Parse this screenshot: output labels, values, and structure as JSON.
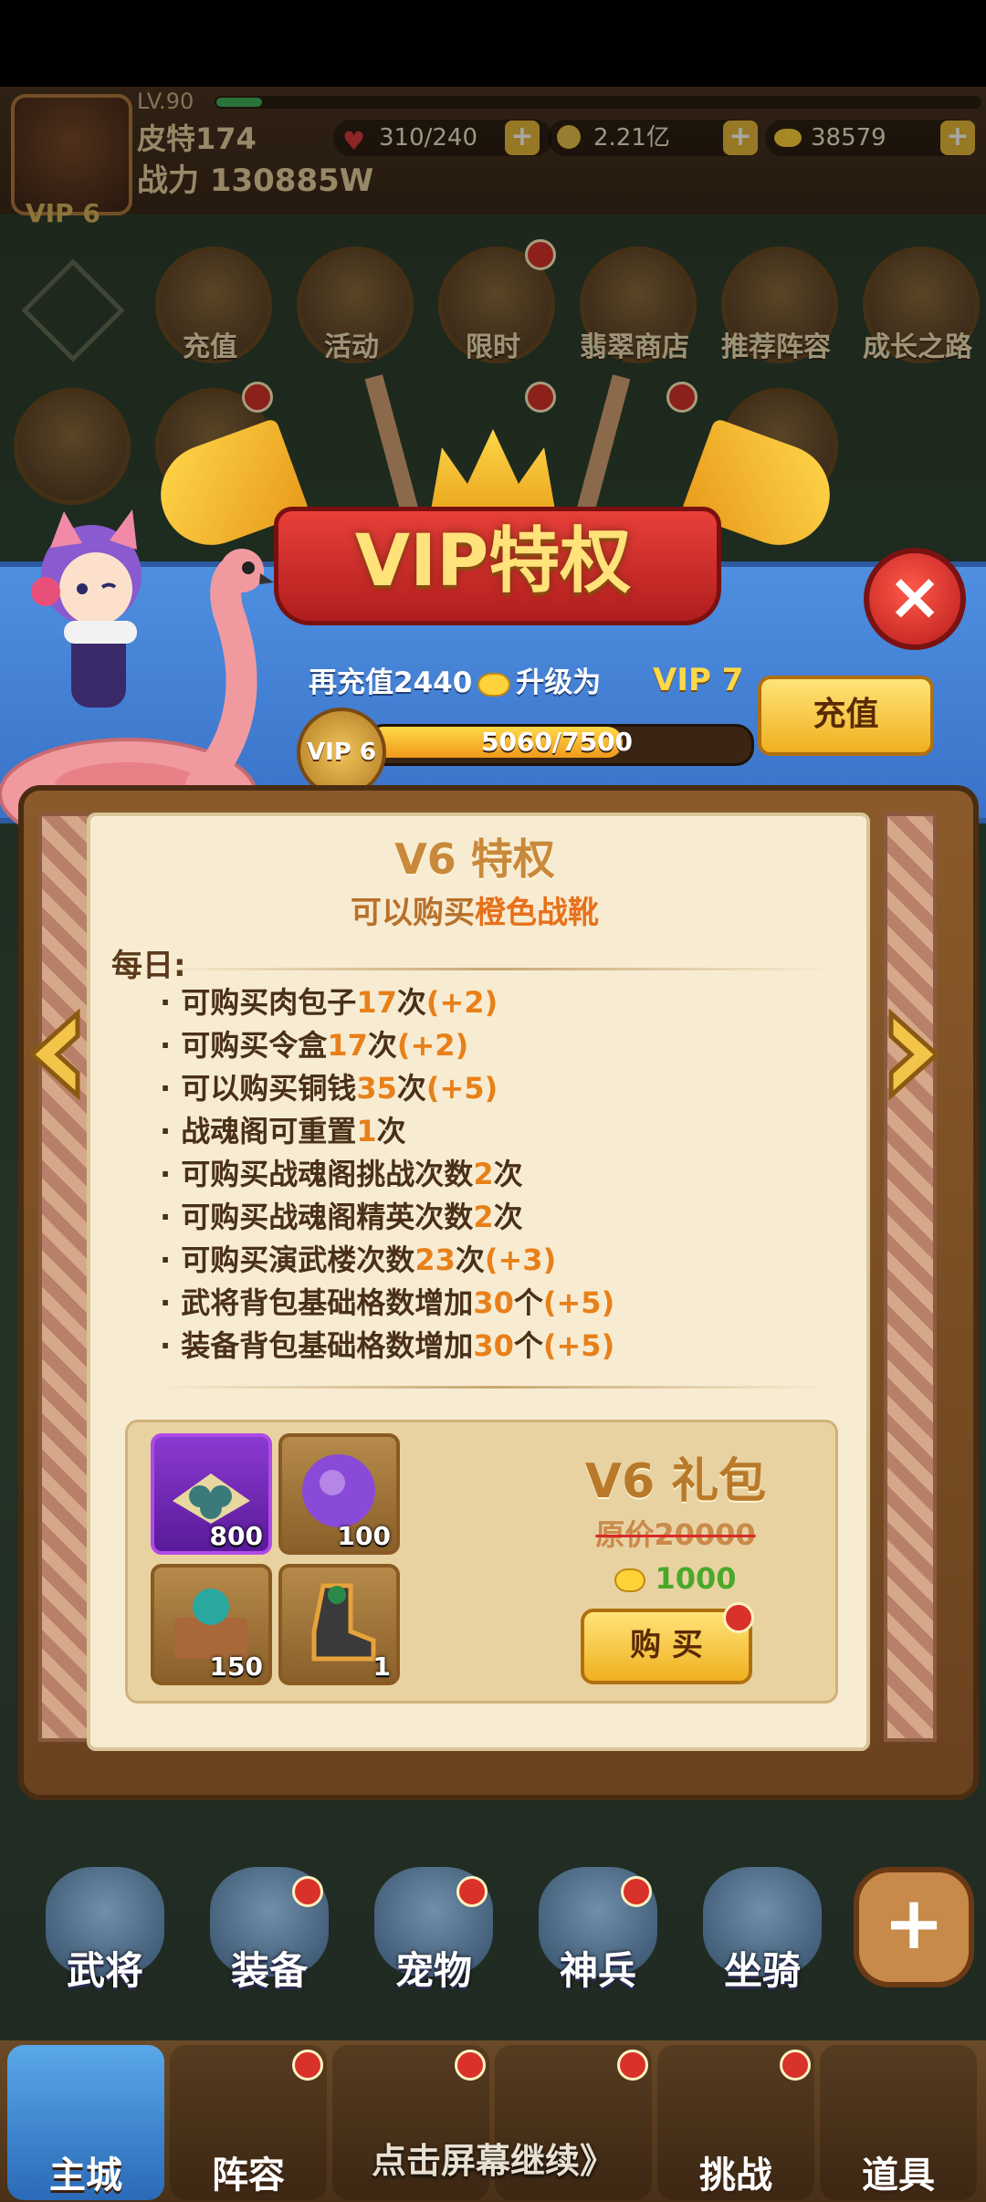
{
  "player": {
    "level": "LV.90",
    "name": "皮特174",
    "power": "战力 130885W",
    "vip": "VIP 6",
    "stamina": "310/240",
    "coins": "2.21亿",
    "gold": "38579"
  },
  "features": [
    {
      "label": "充值",
      "dot": false
    },
    {
      "label": "活动",
      "dot": false
    },
    {
      "label": "限时",
      "dot": true
    },
    {
      "label": "翡翠商店",
      "dot": false
    },
    {
      "label": "推荐阵容",
      "dot": false
    },
    {
      "label": "成长之路",
      "dot": false
    }
  ],
  "vip_panel": {
    "banner_title": "VIP特权",
    "recharge_prefix": "再充值2440",
    "upgrade_to": "升级为",
    "next_vip": "VIP 7",
    "recharge_button": "充值",
    "current_vip": "VIP 6",
    "progress_text": "5060/7500",
    "progress_fraction": 0.675,
    "privilege_title": "V6  特权",
    "privilege_sub_prefix": "可以购买",
    "privilege_sub_highlight": "橙色战靴",
    "daily_label": "每日:",
    "perks": [
      {
        "text": "可购买肉包子",
        "num": "17",
        "unit": "次",
        "inc": "(+2)"
      },
      {
        "text": "可购买令盒",
        "num": "17",
        "unit": "次",
        "inc": "(+2)"
      },
      {
        "text": "可以购买铜钱",
        "num": "35",
        "unit": "次",
        "inc": "(+5)"
      },
      {
        "text": "战魂阁可重置",
        "num": "1",
        "unit": "次",
        "inc": ""
      },
      {
        "text": "可购买战魂阁挑战次数",
        "num": "2",
        "unit": "次",
        "inc": ""
      },
      {
        "text": "可购买战魂阁精英次数",
        "num": "2",
        "unit": "次",
        "inc": ""
      },
      {
        "text": "可购买演武楼次数",
        "num": "23",
        "unit": "次",
        "inc": "(+3)"
      },
      {
        "text": "武将背包基础格数增加",
        "num": "30",
        "unit": "个",
        "inc": "(+5)"
      },
      {
        "text": "装备背包基础格数增加",
        "num": "30",
        "unit": "个",
        "inc": "(+5)"
      }
    ],
    "gift_title": "V6  礼包",
    "gift_original_price": "原价20000",
    "gift_price": "1000",
    "buy_button": "购 买",
    "gift_items": [
      {
        "icon": "jade-stones-icon",
        "count": "800"
      },
      {
        "icon": "purple-orb-icon",
        "count": "100"
      },
      {
        "icon": "treasure-chest-icon",
        "count": "150"
      },
      {
        "icon": "orange-boots-icon",
        "count": "1"
      }
    ]
  },
  "characters": [
    "武将",
    "装备",
    "宠物",
    "神兵",
    "坐骑"
  ],
  "nav": [
    "主城",
    "阵容",
    "",
    "",
    "挑战",
    "道具"
  ],
  "continue_text": "点击屏幕继续》"
}
